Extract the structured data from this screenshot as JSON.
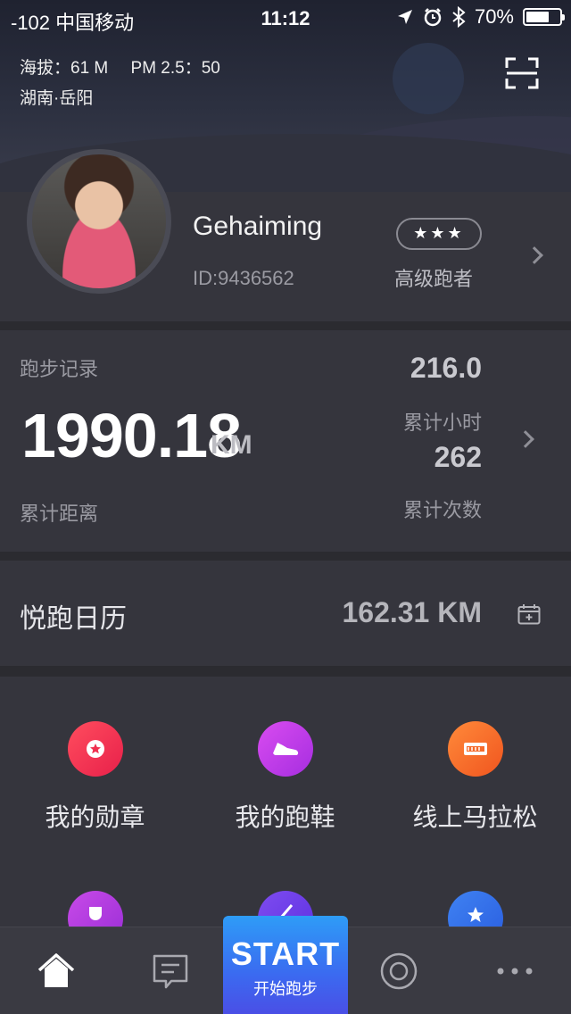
{
  "status_bar": {
    "carrier": "-102 中国移动",
    "time": "11:12",
    "battery": "70%",
    "battery_level": 0.7
  },
  "weather": {
    "altitude": "海拔：61 M",
    "pm": "PM 2.5：50",
    "location": "湖南·岳阳"
  },
  "profile": {
    "username": "Gehaiming",
    "user_id": "ID:9436562",
    "stars": "★★★",
    "rank": "高级跑者"
  },
  "record": {
    "title": "跑步记录",
    "total_distance": "1990.18",
    "distance_unit": "KM",
    "distance_label": "累计距离",
    "total_hours": "216.0",
    "hours_label": "累计小时",
    "total_runs": "262",
    "runs_label": "累计次数"
  },
  "calendar": {
    "title": "悦跑日历",
    "value": "162.31 KM"
  },
  "grid": {
    "items": [
      {
        "label": "我的勋章",
        "icon": "medal-icon",
        "color": "#f0304f"
      },
      {
        "label": "我的跑鞋",
        "icon": "shoe-icon",
        "color": "#c23ae8"
      },
      {
        "label": "线上马拉松",
        "icon": "ticket-icon",
        "color": "#f56a2a"
      },
      {
        "label": "",
        "icon": "trophy-icon",
        "color": "#b43ad8"
      },
      {
        "label": "",
        "icon": "pencil-icon",
        "color": "#6a3ee8"
      },
      {
        "label": "",
        "icon": "star-icon",
        "color": "#2f6fe8"
      }
    ]
  },
  "tabbar": {
    "start_label": "START",
    "start_sub": "开始跑步"
  }
}
